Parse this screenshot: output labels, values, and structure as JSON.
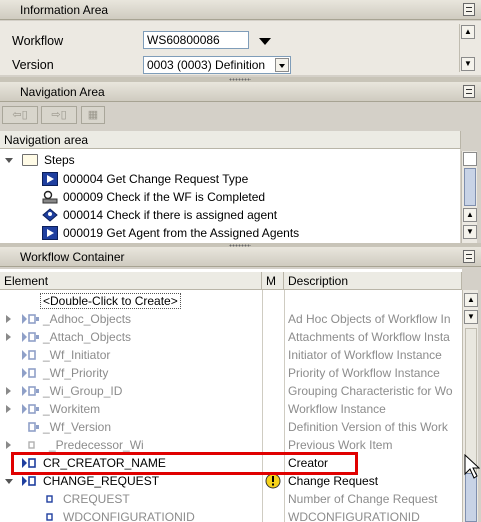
{
  "info_area": {
    "title": "Information Area",
    "workflow_label": "Workflow",
    "workflow_value": "WS60800086",
    "version_label": "Version",
    "version_value": "0003 (0003) Definition"
  },
  "nav_area": {
    "title": "Navigation Area",
    "column_header": "Navigation area",
    "root_label": "Steps",
    "steps": [
      {
        "text": "000004 Get Change Request Type"
      },
      {
        "text": "000009 Check if the WF is Completed"
      },
      {
        "text": "000014 Check if there is assigned agent"
      },
      {
        "text": "000019 Get Agent from the Assigned Agents"
      }
    ]
  },
  "container": {
    "title": "Workflow Container",
    "col_element": "Element",
    "col_m": "M",
    "col_description": "Description",
    "create_label": "<Double-Click to Create>",
    "rows": [
      {
        "element": "_Adhoc_Objects",
        "description": "Ad Hoc Objects of Workflow In"
      },
      {
        "element": "_Attach_Objects",
        "description": "Attachments of Workflow Insta"
      },
      {
        "element": "_Wf_Initiator",
        "description": "Initiator of Workflow Instance"
      },
      {
        "element": "_Wf_Priority",
        "description": "Priority of Workflow Instance"
      },
      {
        "element": "_Wi_Group_ID",
        "description": "Grouping Characteristic for Wo"
      },
      {
        "element": "_Workitem",
        "description": "Workflow Instance"
      },
      {
        "element": "_Wf_Version",
        "description": "Definition Version of this Work"
      },
      {
        "element": "_Predecessor_Wi",
        "description": "Previous Work Item"
      },
      {
        "element": "CR_CREATOR_NAME",
        "description": "Creator"
      },
      {
        "element": "CHANGE_REQUEST",
        "description": "Change Request"
      },
      {
        "element": "CREQUEST",
        "description": "Number of Change Request"
      },
      {
        "element": "WDCONFIGURATIONID",
        "description": "WDCONFIGURATIONID"
      }
    ]
  },
  "colors": {
    "highlight_box": "#e00000",
    "icon_blue": "#1f3f9f",
    "warning_yellow": "#f6d21a"
  }
}
